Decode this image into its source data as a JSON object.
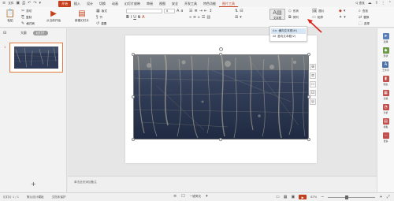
{
  "menubar": {
    "file_label": "文件",
    "tabs": [
      {
        "label": "开始",
        "state": "active"
      },
      {
        "label": "插入",
        "state": ""
      },
      {
        "label": "设计",
        "state": ""
      },
      {
        "label": "切换",
        "state": ""
      },
      {
        "label": "动画",
        "state": ""
      },
      {
        "label": "幻灯片放映",
        "state": ""
      },
      {
        "label": "审阅",
        "state": ""
      },
      {
        "label": "视图",
        "state": ""
      },
      {
        "label": "安全",
        "state": ""
      },
      {
        "label": "开发工具",
        "state": ""
      },
      {
        "label": "特色功能",
        "state": ""
      },
      {
        "label": "图片工具",
        "state": "hl"
      }
    ],
    "search_label": "Q 查找",
    "accent_color": "#c43e1c"
  },
  "ribbon": {
    "paste_label": "粘贴",
    "cut_label": "剪切",
    "copy_label": "复制",
    "format_painter_label": "格式刷",
    "from_current_label": "从当前开始",
    "new_slide_label": "新建幻灯片",
    "layout_label": "版式",
    "section_label": "节",
    "reset_label": "重置",
    "font_value": "",
    "font_size_value": "0",
    "textbox_label": "文本框",
    "shapes_label": "形状",
    "picture_label": "图片",
    "arrange_label": "排列",
    "outline_label": "轮廓",
    "find_label": "查找",
    "replace_label": "替换",
    "select_label": "选择"
  },
  "dropdown": {
    "items": [
      {
        "label": "横向文本框(H)",
        "selected": true
      },
      {
        "label": "竖向文本框(V)",
        "selected": false
      }
    ]
  },
  "leftpanel": {
    "tab_outline": "大纲",
    "tab_slides": "幻灯片",
    "slide_number": "1",
    "add_icon": "+"
  },
  "notes": {
    "placeholder": "单击此处添加备注"
  },
  "rightbar": {
    "items": [
      {
        "label": "选择",
        "icon": "cursor-icon",
        "color": "#5a7fb8"
      },
      {
        "label": "形状",
        "icon": "shape-icon",
        "color": "#6c9a4a"
      },
      {
        "label": "艺术字",
        "icon": "art-text-icon",
        "color": "#4f6fa8"
      },
      {
        "label": "图表",
        "icon": "chart-icon",
        "color": "#c0504d"
      },
      {
        "label": "表格",
        "icon": "table-icon",
        "color": "#c0504d"
      },
      {
        "label": "分析",
        "icon": "analysis-icon",
        "color": "#c0504d"
      },
      {
        "label": "模板",
        "icon": "template-icon",
        "color": "#c0504d"
      },
      {
        "label": "更多",
        "icon": "more-icon",
        "color": "#c0504d"
      }
    ]
  },
  "statusbar": {
    "slide_count": "幻灯片 1 / 1",
    "theme": "默认设计模板",
    "backup": "文档未保护",
    "notes_toggle": "一键美化",
    "zoom": "87%"
  }
}
